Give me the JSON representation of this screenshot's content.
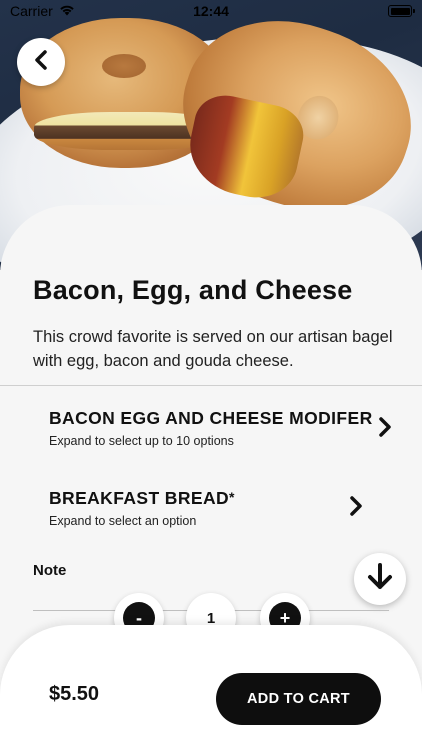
{
  "status_bar": {
    "carrier": "Carrier",
    "time": "12:44"
  },
  "item": {
    "title": "Bacon, Egg, and Cheese",
    "description": "This crowd favorite is served on our artisan bagel with egg, bacon and gouda cheese."
  },
  "modifiers": [
    {
      "title": "BACON EGG AND CHEESE MODIFER",
      "required_mark": "",
      "subtitle": "Expand to select up to 10 options"
    },
    {
      "title": "BREAKFAST BREAD",
      "required_mark": "*",
      "subtitle": "Expand to select an option"
    }
  ],
  "note": {
    "label": "Note"
  },
  "quantity": {
    "minus": "-",
    "value": "1",
    "plus": "+"
  },
  "footer": {
    "price": "$5.50",
    "add_to_cart": "ADD TO CART"
  },
  "icons": {
    "back": "chevron-left-icon",
    "modifier_expand": "chevron-right-icon",
    "scroll_down": "arrow-down-icon",
    "wifi": "wifi-icon",
    "battery": "battery-icon"
  },
  "colors": {
    "background": "#f6f6f6",
    "primary_button": "#0e0e0e",
    "text": "#111111"
  }
}
